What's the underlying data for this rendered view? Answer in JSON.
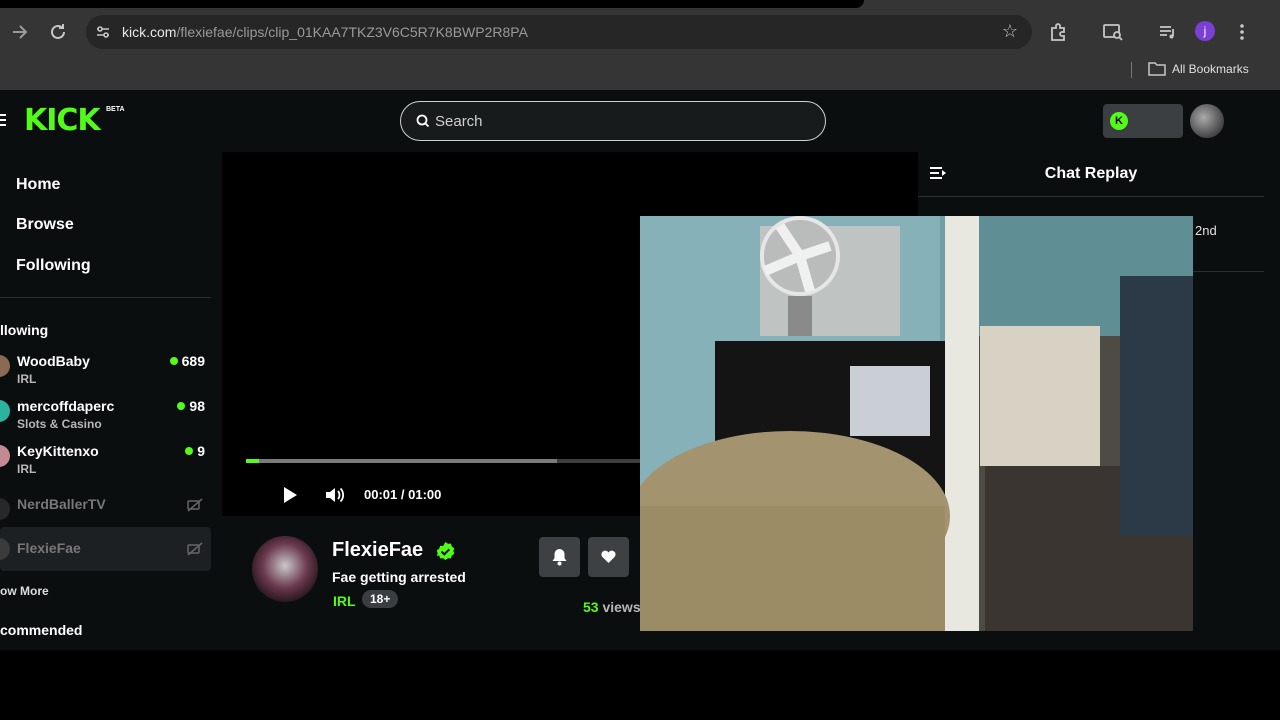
{
  "browser": {
    "url_host": "kick.com",
    "url_path": "/flexiefae/clips/clip_01KAA7TKZ3V6C5R7K8BWP2R8PA",
    "profile_initial": "j",
    "bookmarks_label": "All Bookmarks"
  },
  "kick": {
    "logo": "KICK",
    "beta": "BETA",
    "search_placeholder": "Search"
  },
  "sidebar": {
    "nav": [
      "Home",
      "Browse",
      "Following"
    ],
    "following_heading": "llowing",
    "channels": [
      {
        "name": "WoodBaby",
        "category": "IRL",
        "viewers": "689",
        "live": true
      },
      {
        "name": "mercoffdaperc",
        "category": "Slots & Casino",
        "viewers": "98",
        "live": true
      },
      {
        "name": "KeyKittenxo",
        "category": "IRL",
        "viewers": "9",
        "live": true
      },
      {
        "name": "NerdBallerTV",
        "live": false
      },
      {
        "name": "FlexieFae",
        "live": false
      }
    ],
    "show_more": "ow More",
    "recommended_heading": "commended"
  },
  "player": {
    "time_current": "00:01",
    "time_separator": "/",
    "time_total": "01:00",
    "progress_played": 0.02,
    "progress_buffered": 0.48
  },
  "clip": {
    "channel": "FlexieFae",
    "title": "Fae getting arrested",
    "category": "IRL",
    "age_badge": "18+",
    "views_count": "53",
    "views_label": "views"
  },
  "chat": {
    "title": "Chat Replay",
    "first_message_fragment": "2nd"
  },
  "colors": {
    "kick_green": "#53fc18",
    "page_bg": "#0b0e0f",
    "chrome_bg": "#353535"
  }
}
